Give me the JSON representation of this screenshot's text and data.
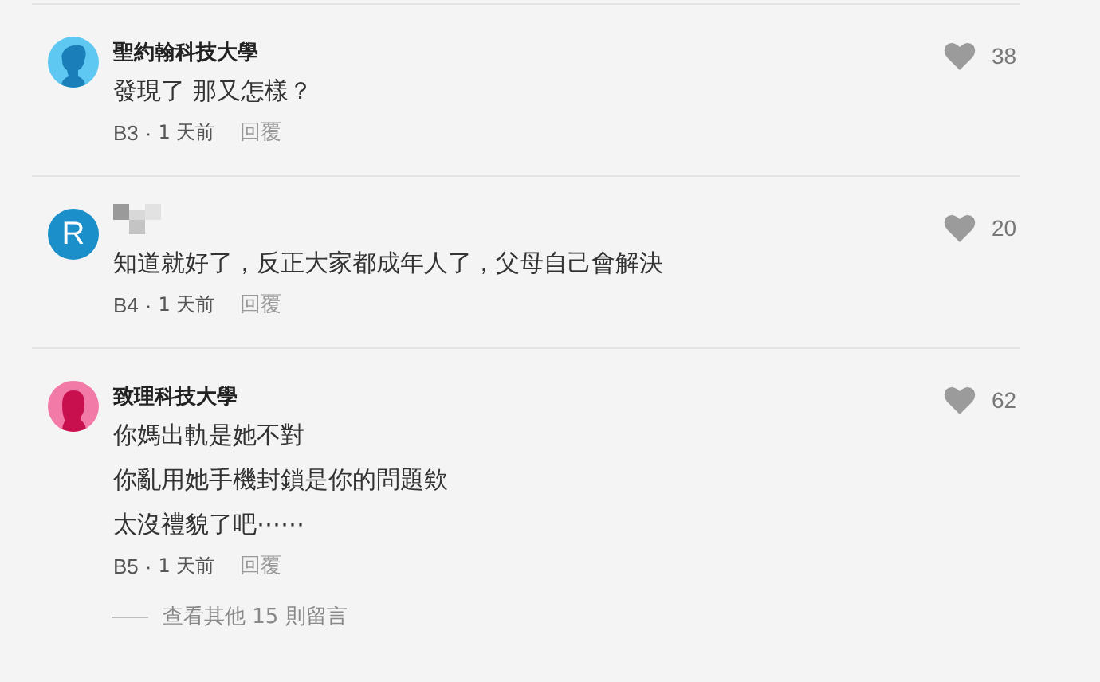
{
  "comments": [
    {
      "avatar": {
        "kind": "silhouette",
        "color": "#5ec8f2"
      },
      "author": "聖約翰科技大學",
      "author_hidden": false,
      "lines": [
        "發現了 那又怎樣？"
      ],
      "floor": "B3",
      "separator": "·",
      "time": "1 天前",
      "reply": "回覆",
      "likes": "38"
    },
    {
      "avatar": {
        "kind": "letter",
        "letter": "R",
        "color": "#1a8fc9"
      },
      "author_hidden": true,
      "lines": [
        "知道就好了，反正大家都成年人了，父母自己會解決"
      ],
      "floor": "B4",
      "separator": "·",
      "time": "1 天前",
      "reply": "回覆",
      "likes": "20"
    },
    {
      "avatar": {
        "kind": "silhouette-female",
        "color": "#f27aa6"
      },
      "author": "致理科技大學",
      "author_hidden": false,
      "lines": [
        "你媽出軌是她不對",
        "你亂用她手機封鎖是你的問題欸",
        "太沒禮貌了吧⋯⋯"
      ],
      "floor": "B5",
      "separator": "·",
      "time": "1 天前",
      "reply": "回覆",
      "likes": "62"
    }
  ],
  "more_replies": "查看其他 15 則留言"
}
